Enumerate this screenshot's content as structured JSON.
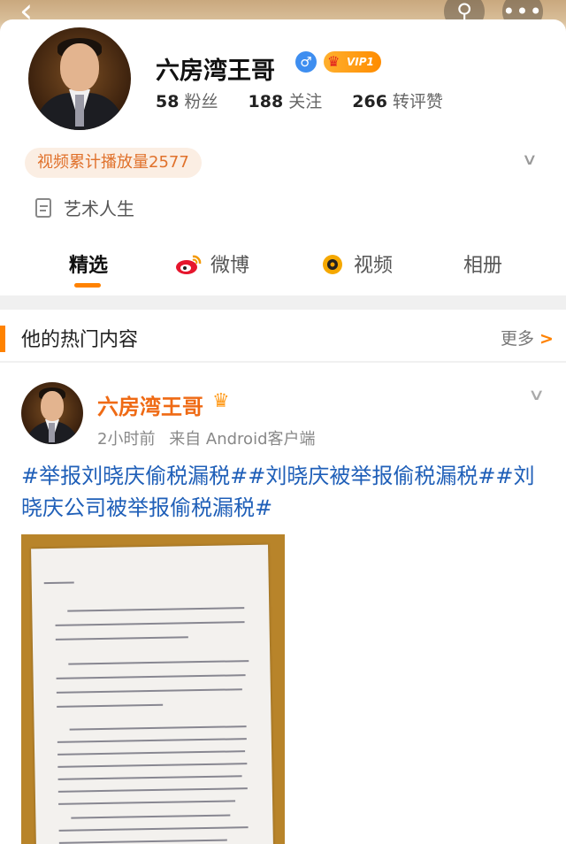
{
  "header": {
    "back_icon": "chevron-left-icon",
    "search_icon": "search-icon",
    "more_icon": "more-dots-icon"
  },
  "profile": {
    "name": "六房湾王哥",
    "gender_icon": "male-icon",
    "vip_label": "VIP1",
    "followers_count": "58",
    "followers_label": "粉丝",
    "following_count": "188",
    "following_label": "关注",
    "likes_count": "266",
    "likes_label": "转评赞",
    "play_count_text": "视频累计播放量2577",
    "bio": "艺术人生"
  },
  "tabs": [
    {
      "label": "精选",
      "active": true
    },
    {
      "label": "微博",
      "icon": "weibo-icon"
    },
    {
      "label": "视频",
      "icon": "video-icon"
    },
    {
      "label": "相册"
    }
  ],
  "section": {
    "title": "他的热门内容",
    "more_label": "更多"
  },
  "post": {
    "author": "六房湾王哥",
    "time": "2小时前",
    "source": "来自 Android客户端",
    "text": "#举报刘晓庆偷税漏税##刘晓庆被举报偷税漏税##刘晓庆公司被举报偷税漏税#"
  },
  "colors": {
    "accent": "#ff8200",
    "topic_blue": "#1f5fb8",
    "author_orange": "#ef6a14"
  }
}
